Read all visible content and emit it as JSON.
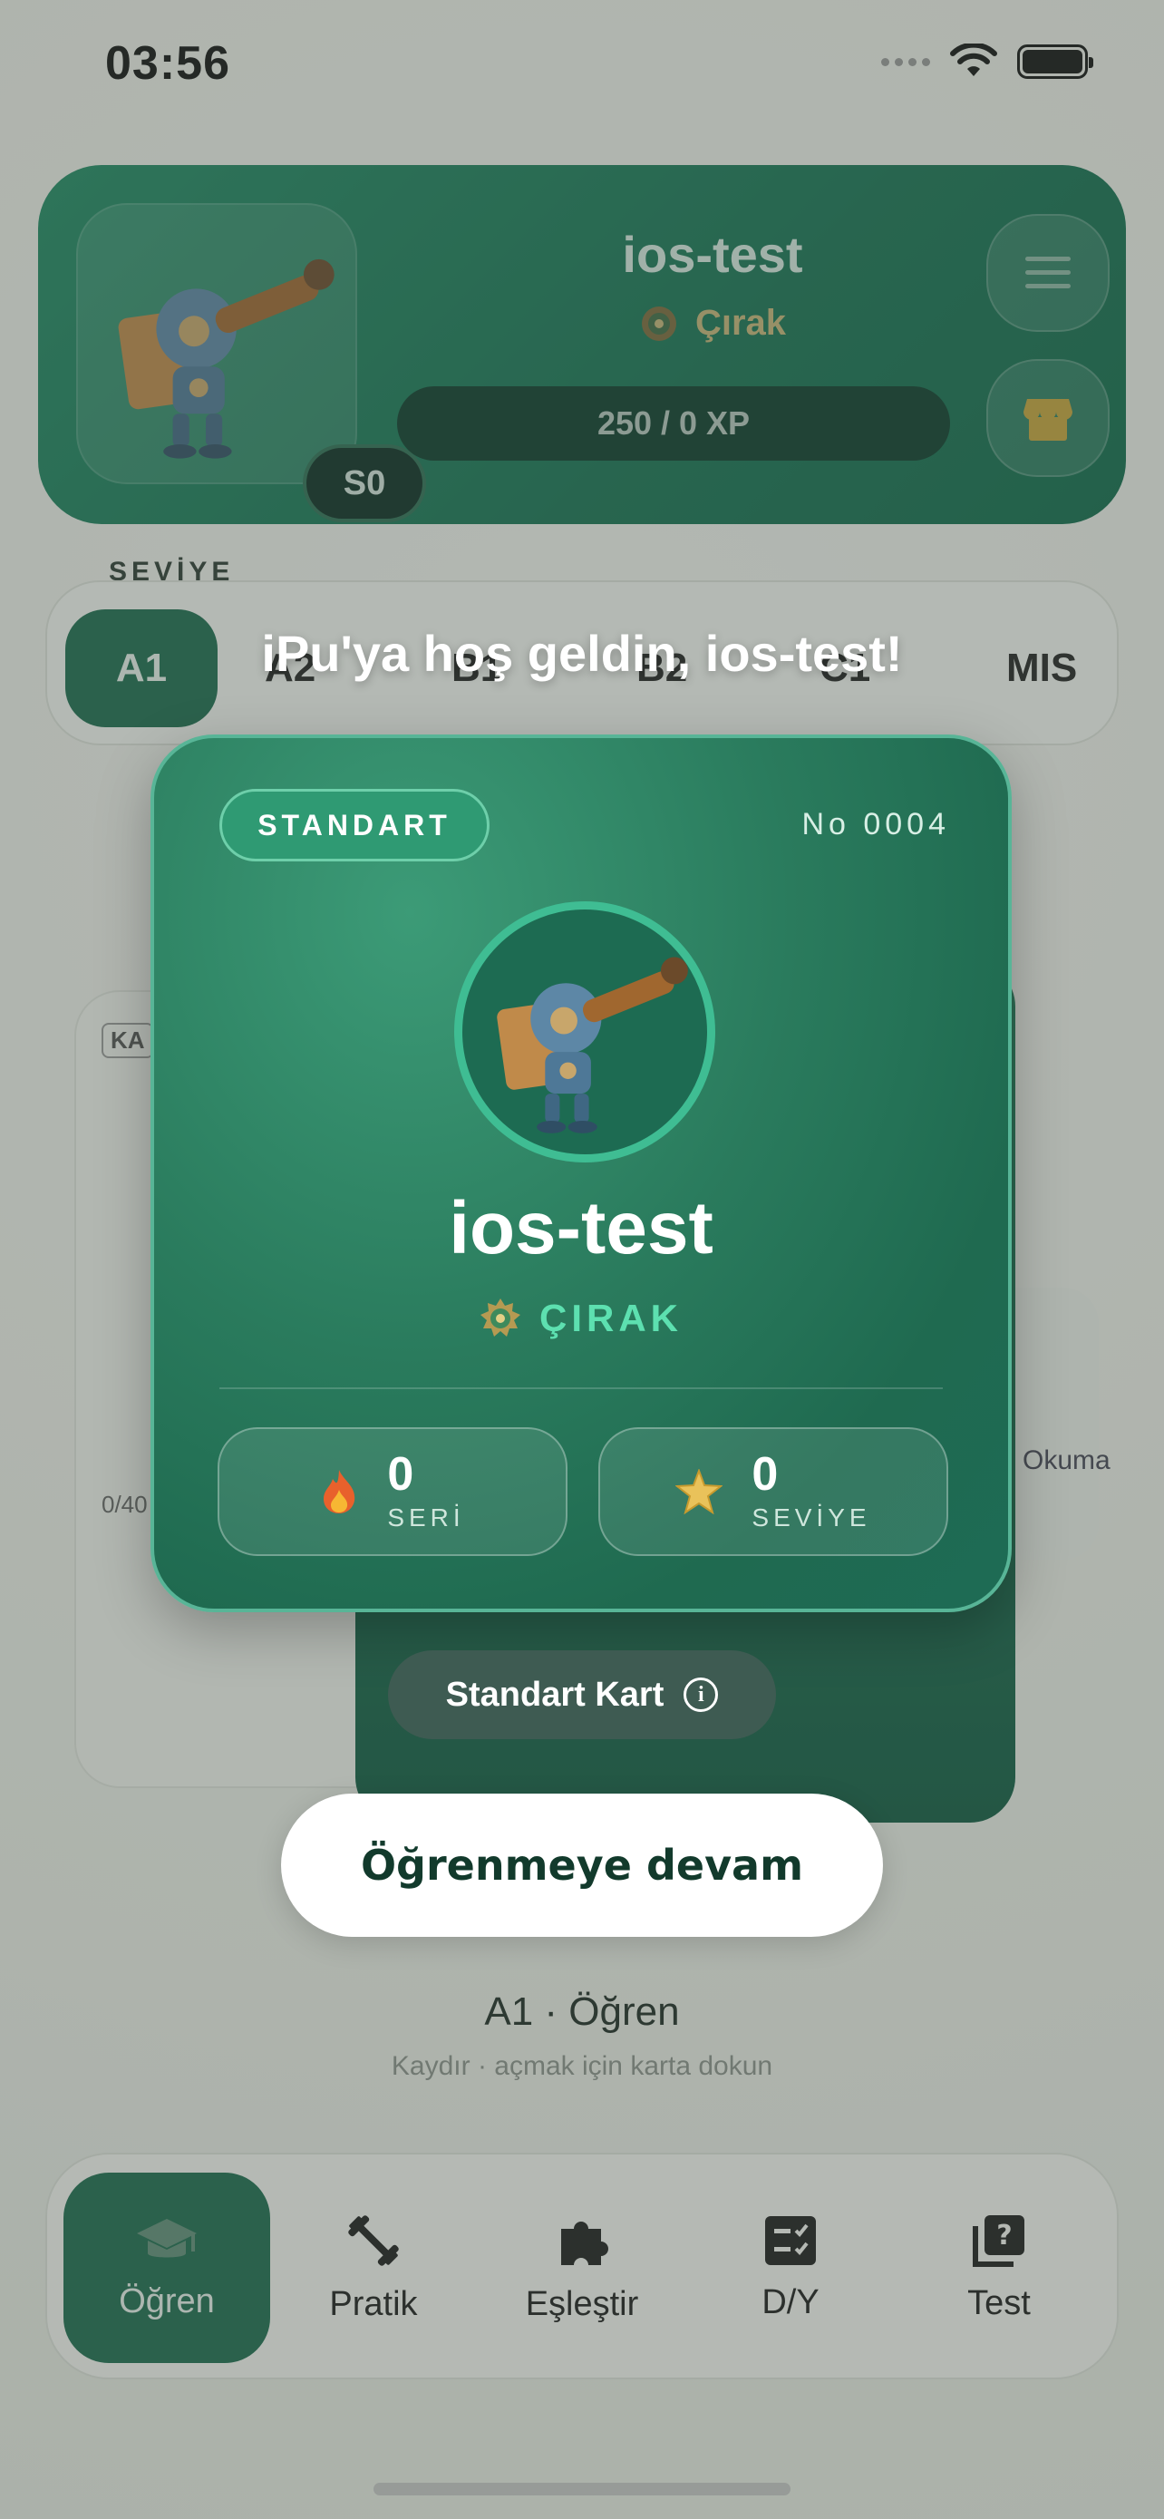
{
  "status_bar": {
    "time": "03:56"
  },
  "profile": {
    "username": "ios-test",
    "rank": "Çırak",
    "season_badge": "S0",
    "xp_text": "250 / 0 XP"
  },
  "levels": {
    "section_label": "SEVİYE",
    "active": "A1",
    "items": [
      "A2",
      "B1",
      "B2",
      "C1",
      "MIS"
    ]
  },
  "background_cards": {
    "left_tag": "KA",
    "left_progress": "0/40",
    "side_label": "Okuma"
  },
  "learn": {
    "title": "A1 · Öğren",
    "subtitle": "Kaydır · açmak için karta dokun"
  },
  "tabs": [
    {
      "label": "Öğren",
      "icon": "graduation-cap-icon",
      "active": true
    },
    {
      "label": "Pratik",
      "icon": "dumbbell-icon",
      "active": false
    },
    {
      "label": "Eşleştir",
      "icon": "puzzle-icon",
      "active": false
    },
    {
      "label": "D/Y",
      "icon": "checklist-icon",
      "active": false
    },
    {
      "label": "Test",
      "icon": "quiz-icon",
      "active": false
    }
  ],
  "welcome": {
    "title": "iPu'ya hoş geldin, ios-test!",
    "card": {
      "tier": "STANDART",
      "number": "No 0004",
      "username": "ios-test",
      "rank": "ÇIRAK",
      "stats": [
        {
          "value": "0",
          "label": "SERİ",
          "icon": "fire-icon"
        },
        {
          "value": "0",
          "label": "SEVİYE",
          "icon": "star-icon"
        }
      ]
    },
    "card_type_label": "Standart Kart",
    "continue_label": "Öğrenmeye devam"
  },
  "colors": {
    "brand_green": "#1a6b4e",
    "card_border": "#58b597",
    "rank_accent": "#5de0b0"
  }
}
